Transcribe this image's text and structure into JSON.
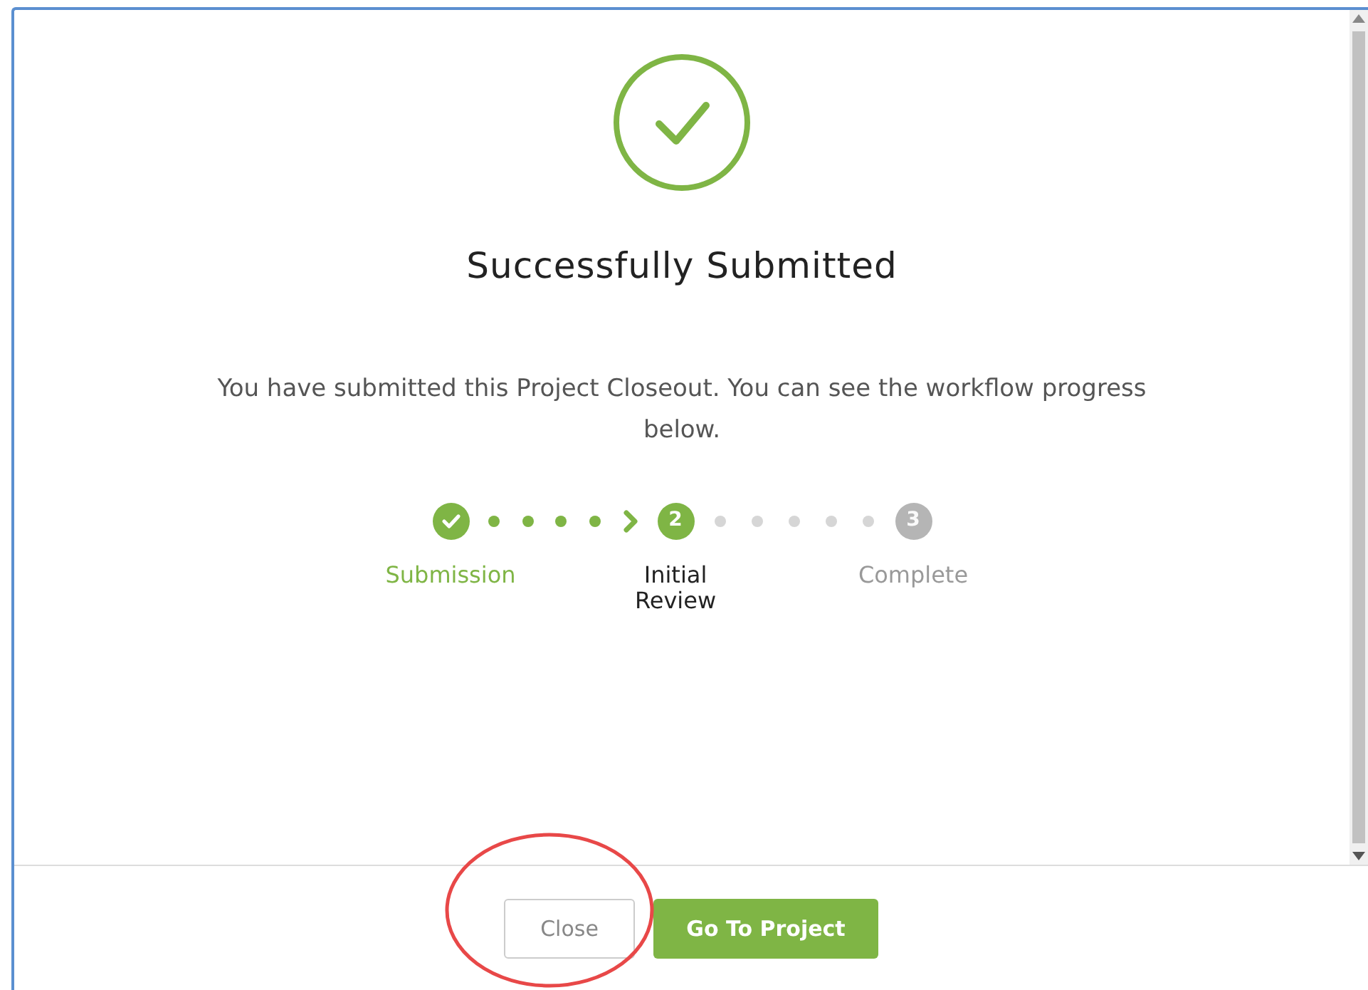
{
  "dialog": {
    "title": "Successfully Submitted",
    "message": "You have submitted this Project Closeout. You can see the workflow progress below."
  },
  "workflow": [
    {
      "label": "Submission",
      "done": true,
      "current": false
    },
    {
      "label": "Initial Review",
      "number": "2",
      "done": false,
      "current": true
    },
    {
      "label": "Complete",
      "number": "3",
      "done": false,
      "current": false
    }
  ],
  "buttons": [
    {
      "label": "Close",
      "kind": "secondary"
    },
    {
      "label": "Go To Project",
      "kind": "primary"
    }
  ]
}
